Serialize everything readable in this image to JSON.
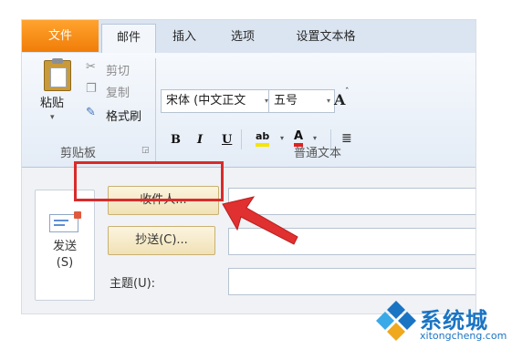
{
  "tabs": [
    "文件",
    "邮件",
    "插入",
    "选项",
    "设置文本格"
  ],
  "clipboard": {
    "paste_label": "粘贴",
    "cut_label": "剪切",
    "copy_label": "复制",
    "format_painter_label": "格式刷",
    "group_label": "剪贴板",
    "cut_icon": "scissors-icon",
    "copy_icon": "copy-icon",
    "format_painter_icon": "brush-icon"
  },
  "font": {
    "family": "宋体 (中文正文",
    "size": "五号",
    "grow_glyph": "A",
    "bold": "B",
    "italic": "I",
    "underline": "U",
    "highlight_glyph": "ab",
    "color_glyph": "A",
    "group_label": "普通文本"
  },
  "compose": {
    "send_label": "发送",
    "send_shortcut": "(S)",
    "to_button": "收件人...",
    "cc_button": "抄送(C)...",
    "subject_label": "主题(U):"
  },
  "colors": {
    "file_tab": "#f07d08",
    "highlight_red": "#d92b2b",
    "brand_blue": "#1a74c4"
  },
  "watermark": {
    "title": "系统城",
    "url": "xitongcheng.com"
  }
}
